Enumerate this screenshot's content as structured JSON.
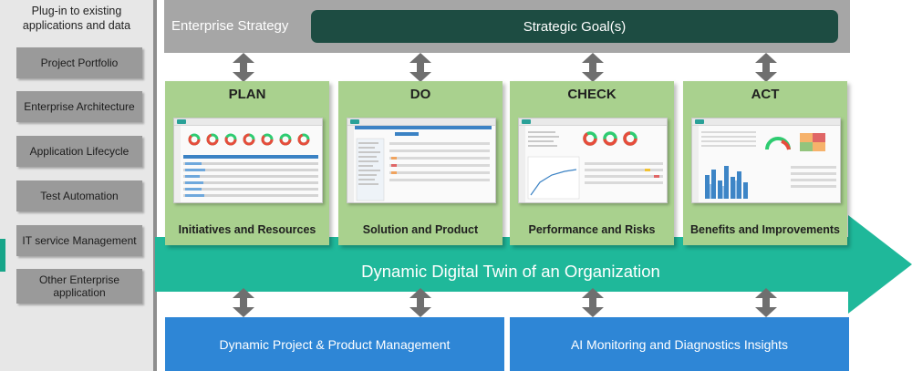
{
  "sidebar": {
    "title": "Plug-in to existing applications and data",
    "items": [
      {
        "label": "Project Portfolio"
      },
      {
        "label": "Enterprise Architecture"
      },
      {
        "label": "Application Lifecycle"
      },
      {
        "label": "Test Automation"
      },
      {
        "label": "IT service Management"
      },
      {
        "label": "Other Enterprise application"
      }
    ]
  },
  "strategy": {
    "label": "Enterprise Strategy",
    "goal": "Strategic Goal(s)"
  },
  "phases": [
    {
      "title": "PLAN",
      "subtitle": "Initiatives and Resources"
    },
    {
      "title": "DO",
      "subtitle": "Solution and Product"
    },
    {
      "title": "CHECK",
      "subtitle": "Performance and Risks"
    },
    {
      "title": "ACT",
      "subtitle": "Benefits and Improvements"
    }
  ],
  "twin": {
    "label": "Dynamic Digital Twin of an Organization"
  },
  "bottom": [
    {
      "label": "Dynamic Project & Product Management"
    },
    {
      "label": "AI Monitoring and Diagnostics Insights"
    }
  ],
  "colors": {
    "card_green": "#a9d18e",
    "strategy_gray": "#a6a6a6",
    "goal_dark": "#1d4c42",
    "twin_teal": "#1fb89a",
    "bottom_blue": "#2e86d6",
    "arrow_gray": "#6f6f6f"
  }
}
